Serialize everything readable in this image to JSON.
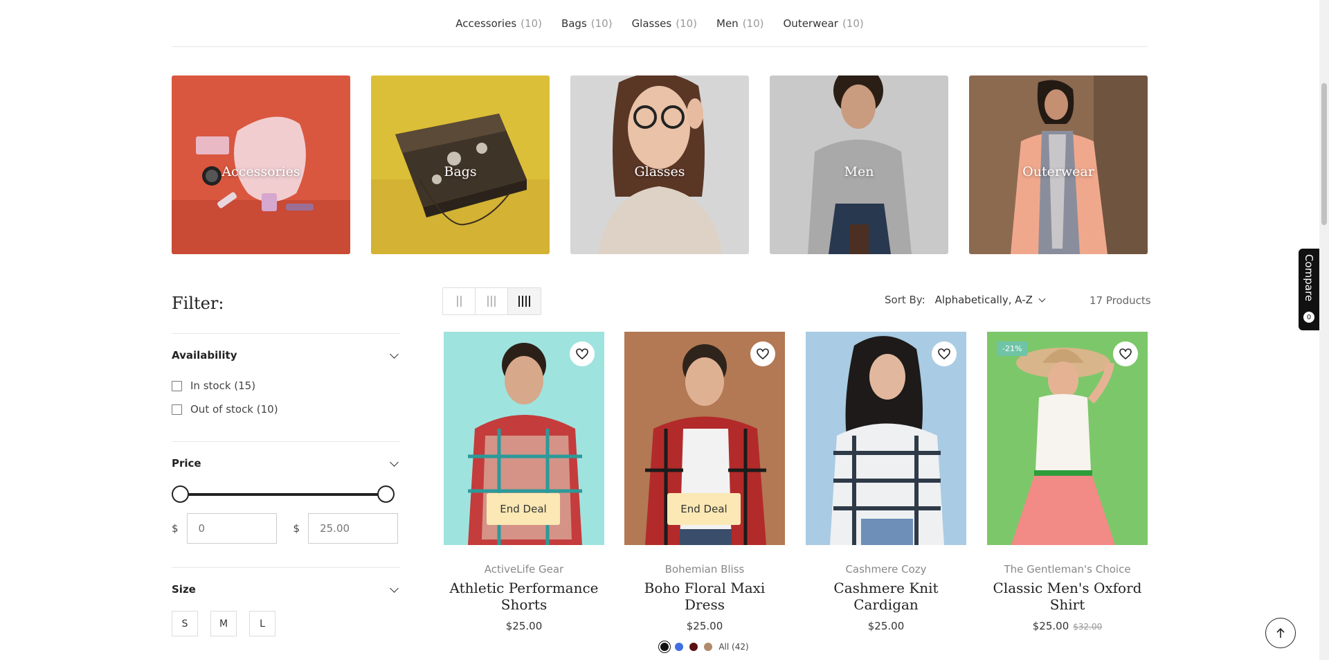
{
  "categories_nav": [
    {
      "label": "Accessories",
      "count": "(10)"
    },
    {
      "label": "Bags",
      "count": "(10)"
    },
    {
      "label": "Glasses",
      "count": "(10)"
    },
    {
      "label": "Men",
      "count": "(10)"
    },
    {
      "label": "Outerwear",
      "count": "(10)"
    }
  ],
  "tiles": [
    {
      "label": "Accessories"
    },
    {
      "label": "Bags"
    },
    {
      "label": "Glasses"
    },
    {
      "label": "Men"
    },
    {
      "label": "Outerwear"
    }
  ],
  "filter": {
    "title": "Filter:",
    "availability": {
      "heading": "Availability",
      "options": [
        "In stock (15)",
        "Out of stock (10)"
      ]
    },
    "price": {
      "heading": "Price",
      "currency": "$",
      "min_value": "0",
      "max_placeholder": "25.00",
      "range_min_fraction": 0.0,
      "range_max_fraction": 1.0
    },
    "size": {
      "heading": "Size",
      "options": [
        "S",
        "M",
        "L"
      ]
    }
  },
  "toolbar": {
    "sort_label": "Sort By:",
    "sort_value": "Alphabetically, A-Z",
    "count": "17 Products"
  },
  "products": [
    {
      "brand": "ActiveLife Gear",
      "name": "Athletic Performance Shorts",
      "price": "$25.00",
      "deal": "End Deal"
    },
    {
      "brand": "Bohemian Bliss",
      "name": "Boho Floral Maxi Dress",
      "price": "$25.00",
      "deal": "End Deal",
      "swatch_all": "All (42)",
      "swatches": [
        "#111111",
        "#3f6fe0",
        "#5a1010",
        "#b08a6a"
      ]
    },
    {
      "brand": "Cashmere Cozy",
      "name": "Cashmere Knit Cardigan",
      "price": "$25.00"
    },
    {
      "brand": "The Gentleman's Choice",
      "name": "Classic Men's Oxford Shirt",
      "price": "$25.00",
      "compare_price": "$32.00",
      "badge": "-21%"
    }
  ],
  "compare": {
    "label": "Compare",
    "count": "0"
  },
  "colors": {
    "accent_deal": "#fbe8b4",
    "badge": "#6fc4a7"
  }
}
